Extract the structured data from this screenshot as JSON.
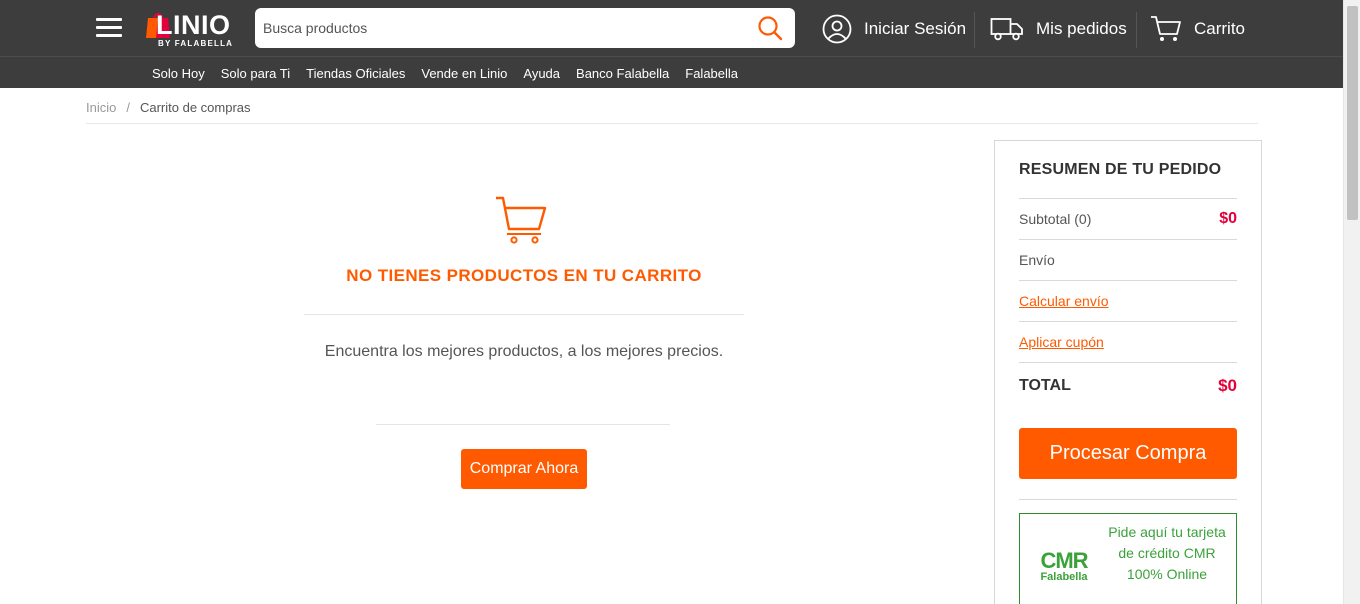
{
  "header": {
    "logo_text": "LINIO",
    "logo_subtext": "BY FALABELLA",
    "search_placeholder": "Busca productos",
    "login_label": "Iniciar Sesión",
    "orders_label": "Mis pedidos",
    "cart_label": "Carrito"
  },
  "nav": {
    "items": [
      "Solo Hoy",
      "Solo para Ti",
      "Tiendas Oficiales",
      "Vende en Linio",
      "Ayuda",
      "Banco Falabella",
      "Falabella"
    ]
  },
  "breadcrumb": {
    "home": "Inicio",
    "separator": "/",
    "current": "Carrito de compras"
  },
  "empty_cart": {
    "title": "NO TIENES PRODUCTOS EN TU CARRITO",
    "subtitle": "Encuentra los mejores productos, a los mejores precios.",
    "button_label": "Comprar Ahora"
  },
  "summary": {
    "title": "RESUMEN DE TU PEDIDO",
    "subtotal_label": "Subtotal (0)",
    "subtotal_value": "$0",
    "shipping_label": "Envío",
    "calc_shipping_link": "Calcular envío",
    "apply_coupon_link": "Aplicar cupón",
    "total_label": "TOTAL",
    "total_value": "$0",
    "process_button": "Procesar Compra",
    "cmr_logo_big": "CMR",
    "cmr_logo_small": "Falabella",
    "cmr_text": "Pide aquí tu tarjeta de crédito CMR 100% Online"
  },
  "colors": {
    "brand_orange": "#ff5a00",
    "price_red": "#e4003a",
    "header_bg": "#3d3d3d",
    "cmr_green": "#3ba23b"
  }
}
